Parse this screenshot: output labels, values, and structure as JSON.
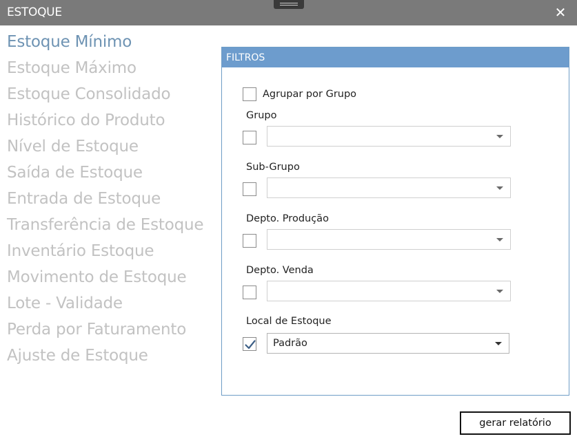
{
  "window": {
    "title": "ESTOQUE",
    "close_glyph": "✕"
  },
  "menu": {
    "items": [
      {
        "label": "Estoque Mínimo",
        "active": true
      },
      {
        "label": "Estoque Máximo"
      },
      {
        "label": "Estoque Consolidado"
      },
      {
        "label": "Histórico do Produto"
      },
      {
        "label": "Nível de Estoque"
      },
      {
        "label": "Saída de Estoque"
      },
      {
        "label": "Entrada de Estoque"
      },
      {
        "label": "Transferência de Estoque"
      },
      {
        "label": "Inventário Estoque"
      },
      {
        "label": "Movimento de Estoque"
      },
      {
        "label": "Lote - Validade"
      },
      {
        "label": "Perda por Faturamento"
      },
      {
        "label": "Ajuste de Estoque"
      }
    ]
  },
  "filters": {
    "title": "FILTROS",
    "agrupar": {
      "label": "Agrupar por Grupo",
      "checked": false
    },
    "grupo": {
      "label": "Grupo",
      "checked": false,
      "value": ""
    },
    "subgrupo": {
      "label": "Sub-Grupo",
      "checked": false,
      "value": ""
    },
    "depto_producao": {
      "label": "Depto. Produção",
      "checked": false,
      "value": ""
    },
    "depto_venda": {
      "label": "Depto. Venda",
      "checked": false,
      "value": ""
    },
    "local_estoque": {
      "label": "Local de Estoque",
      "checked": true,
      "value": "Padrão"
    }
  },
  "actions": {
    "generate_label": "gerar relatório"
  },
  "colors": {
    "titlebar": "#7a7a7a",
    "panel_header": "#6d9ccd",
    "menu_active": "#6e93b3",
    "menu_inactive": "#c2c2c2",
    "checkmark": "#3d5f86"
  }
}
